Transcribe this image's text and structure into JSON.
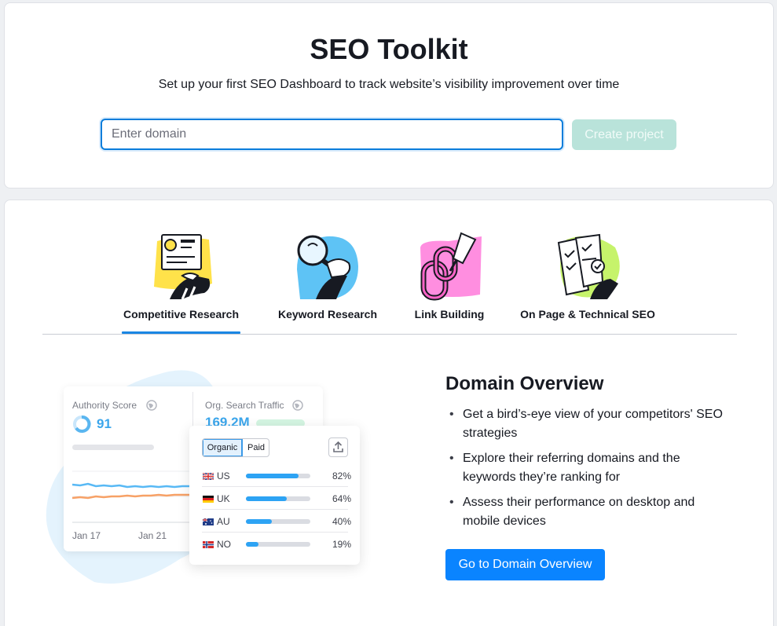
{
  "header": {
    "title": "SEO Toolkit",
    "subtitle": "Set up your first SEO Dashboard to track website’s visibility improvement over time"
  },
  "domain_form": {
    "placeholder": "Enter domain",
    "value": "",
    "create_button": "Create project"
  },
  "tabs": [
    {
      "label": "Competitive Research",
      "icon": "competitive-research-illustration",
      "active": true
    },
    {
      "label": "Keyword Research",
      "icon": "magnifier-illustration",
      "active": false
    },
    {
      "label": "Link Building",
      "icon": "chain-link-illustration",
      "active": false
    },
    {
      "label": "On Page & Technical SEO",
      "icon": "checklist-illustration",
      "active": false
    }
  ],
  "preview": {
    "authority_label": "Authority Score",
    "authority_value": "91",
    "traffic_label": "Org. Search Traffic",
    "traffic_value": "169.2M",
    "x_labels": [
      "Jan 17",
      "Jan 21"
    ],
    "toggle": [
      "Organic",
      "Paid"
    ],
    "countries": [
      {
        "code": "US",
        "percent": "82%",
        "share": 0.82
      },
      {
        "code": "UK",
        "percent": "64%",
        "share": 0.64
      },
      {
        "code": "AU",
        "percent": "40%",
        "share": 0.4
      },
      {
        "code": "NO",
        "percent": "19%",
        "share": 0.19
      }
    ]
  },
  "domain_overview": {
    "title": "Domain Overview",
    "bullets": [
      "Get a bird’s-eye view of your competitors' SEO strategies",
      "Explore their referring domains and the keywords they’re ranking for",
      "Assess their performance on desktop and mobile devices"
    ],
    "button": "Go to Domain Overview"
  },
  "colors": {
    "accent": "#0a84ff",
    "tab_underline": "#1a86e3",
    "create_button_disabled": "#b9e3da",
    "bar_fill": "#2da3f4",
    "chart_blue": "#58b9f5",
    "chart_orange": "#f7a166"
  }
}
